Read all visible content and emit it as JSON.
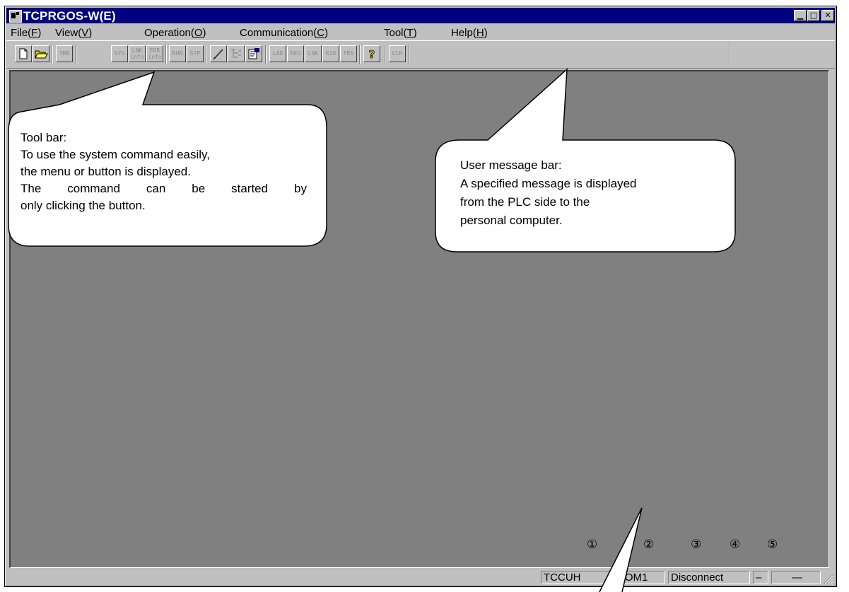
{
  "window": {
    "title": "TCPRGOS-W(E)",
    "controls": [
      "minimize",
      "maximize",
      "close"
    ]
  },
  "menu": [
    {
      "label": "File",
      "key": "F"
    },
    {
      "label": "View",
      "key": "V"
    },
    {
      "label": "Operation",
      "key": "O"
    },
    {
      "label": "Communication",
      "key": "C"
    },
    {
      "label": "Tool",
      "key": "T"
    },
    {
      "label": "Help",
      "key": "H"
    }
  ],
  "toolbar": {
    "buttons": [
      {
        "label": "",
        "icon": "new-file-icon"
      },
      {
        "label": "",
        "icon": "open-folder-icon"
      },
      {
        "label": "TRN"
      },
      {
        "label": "SYS"
      },
      {
        "label": "LNK info"
      },
      {
        "label": "ERR info"
      },
      {
        "label": "RUN"
      },
      {
        "label": "STP"
      },
      {
        "label": "",
        "icon": "pencil-icon"
      },
      {
        "label": "",
        "icon": "tree-icon"
      },
      {
        "label": "",
        "icon": "properties-icon"
      },
      {
        "label": "LAD"
      },
      {
        "label": "REG"
      },
      {
        "label": "LNK"
      },
      {
        "label": "RIO"
      },
      {
        "label": "FRS"
      },
      {
        "label": "",
        "icon": "help-question-icon"
      },
      {
        "label": "CLR"
      }
    ]
  },
  "callouts": {
    "toolbar": {
      "lines": [
        "Tool bar:",
        "To use the system command easily,",
        "the menu or button is displayed.",
        "The command can be started by",
        "only clicking the button."
      ]
    },
    "message_bar": {
      "lines": [
        "User message bar:",
        "A specified message is displayed",
        "from the PLC side to the",
        "personal computer."
      ]
    }
  },
  "status_numbers": [
    "①",
    "②",
    "③",
    "④",
    "⑤"
  ],
  "statusbar": {
    "cells": [
      "TCCUH",
      "COM1",
      "Disconnect",
      "–",
      "—"
    ]
  }
}
